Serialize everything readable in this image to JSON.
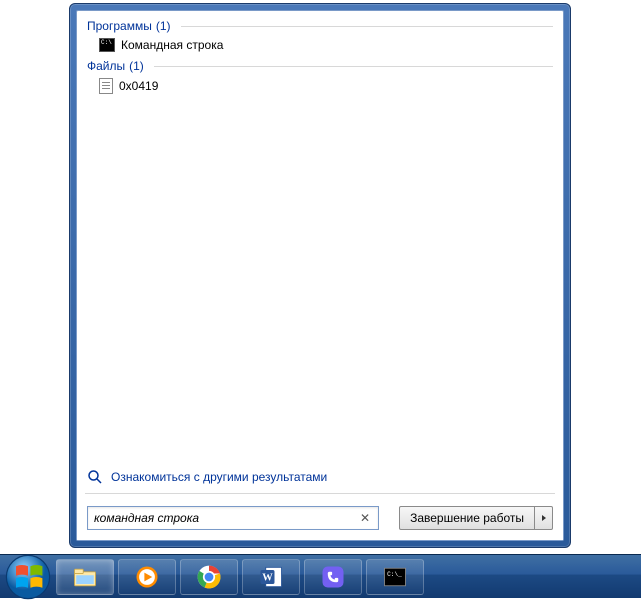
{
  "groups": [
    {
      "title": "Программы",
      "count": "(1)",
      "items": [
        {
          "icon": "cmd",
          "label": "Командная строка"
        }
      ]
    },
    {
      "title": "Файлы",
      "count": "(1)",
      "items": [
        {
          "icon": "file",
          "label": "0x0419"
        }
      ]
    }
  ],
  "see_more": "Ознакомиться с другими результатами",
  "search_value": "командная строка",
  "shutdown_label": "Завершение работы",
  "taskbar": {
    "items": [
      "explorer",
      "media-player",
      "chrome",
      "word",
      "viber",
      "cmd"
    ]
  }
}
